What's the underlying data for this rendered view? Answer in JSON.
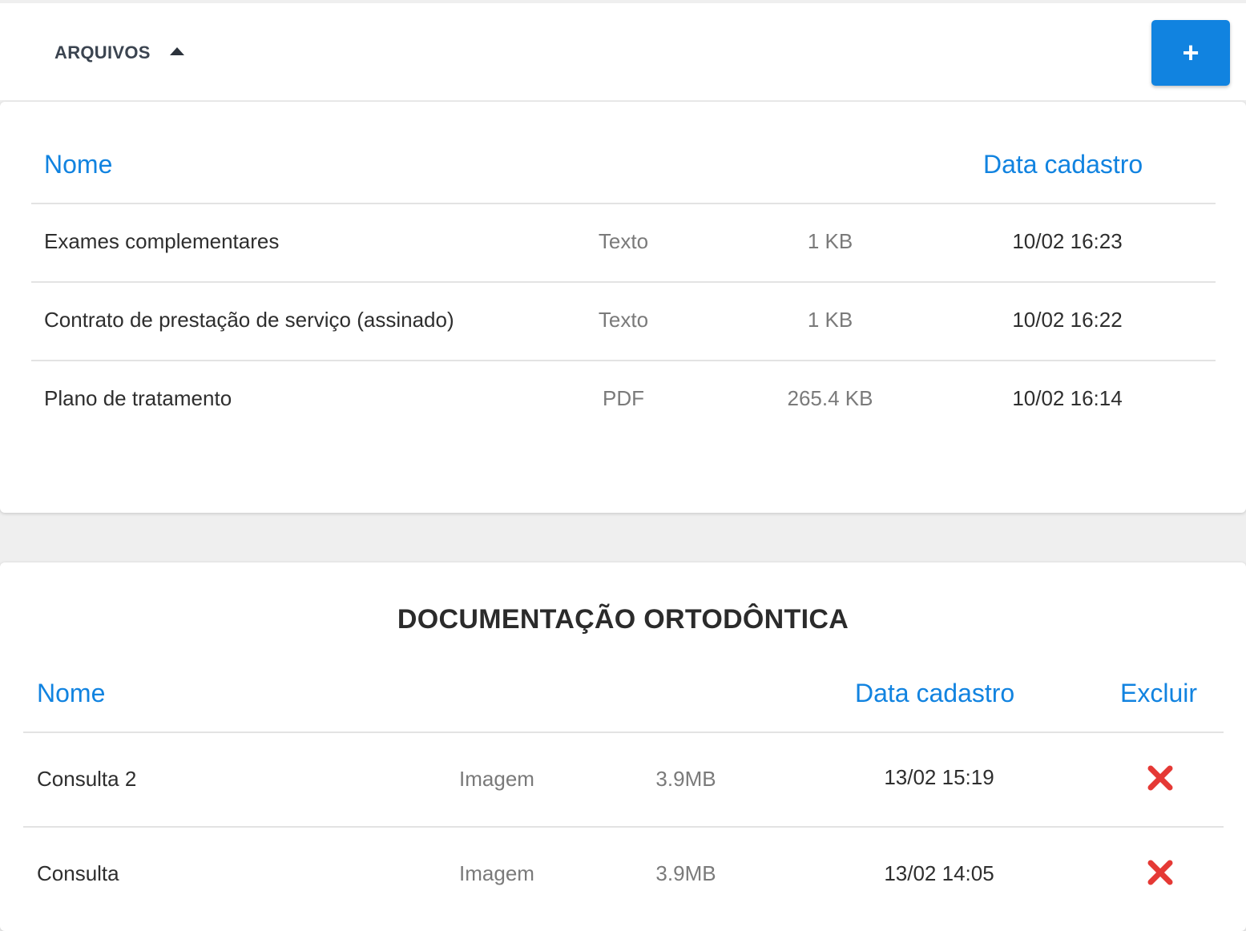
{
  "header": {
    "section_label": "ARQUIVOS",
    "add_label": "+"
  },
  "files": {
    "columns": {
      "name": "Nome",
      "date": "Data cadastro"
    },
    "rows": [
      {
        "name": "Exames complementares",
        "type": "Texto",
        "size": "1 KB",
        "date": "10/02 16:23"
      },
      {
        "name": "Contrato de prestação de serviço (assinado)",
        "type": "Texto",
        "size": "1 KB",
        "date": "10/02 16:22"
      },
      {
        "name": "Plano de tratamento",
        "type": "PDF",
        "size": "265.4 KB",
        "date": "10/02 16:14"
      }
    ]
  },
  "ortho": {
    "title": "DOCUMENTAÇÃO ORTODÔNTICA",
    "columns": {
      "name": "Nome",
      "date": "Data cadastro",
      "delete": "Excluir"
    },
    "rows": [
      {
        "name": "Consulta 2",
        "type": "Imagem",
        "size": "3.9MB",
        "date": "13/02 15:19"
      },
      {
        "name": "Consulta",
        "type": "Imagem",
        "size": "3.9MB",
        "date": "13/02 14:05"
      }
    ]
  },
  "colors": {
    "accent": "#1183e0",
    "delete": "#e53935"
  },
  "icons": {
    "toggle": "caret-up-icon",
    "add": "plus-icon",
    "delete": "red-x-icon"
  }
}
